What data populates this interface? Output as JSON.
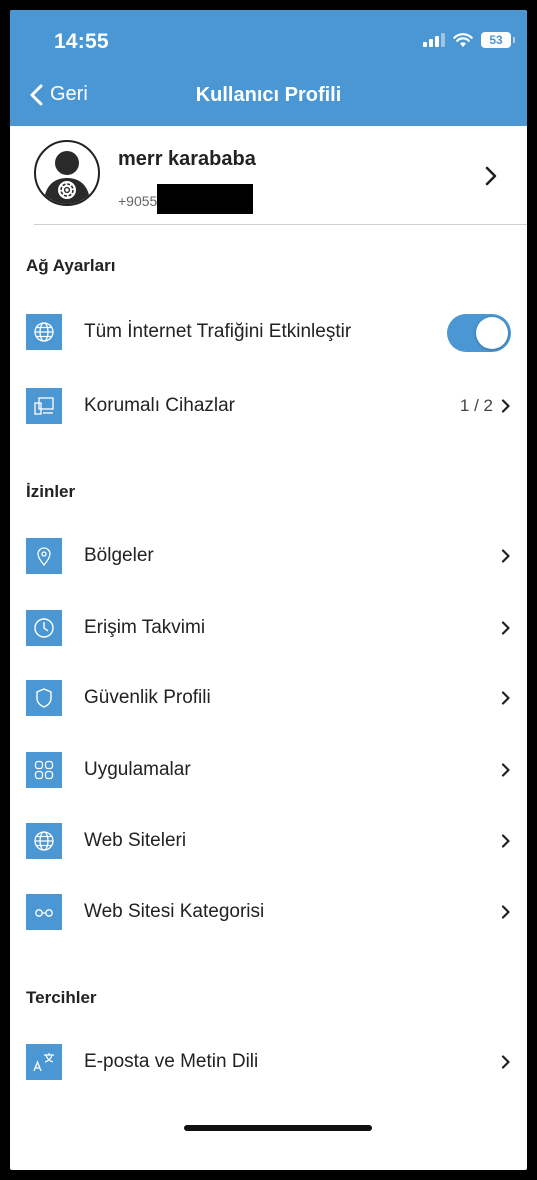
{
  "status_bar": {
    "time": "14:55",
    "battery": "53"
  },
  "nav": {
    "back_label": "Geri",
    "title": "Kullanıcı Profili"
  },
  "profile": {
    "name": "merr karababa",
    "phone_visible": "+9055"
  },
  "sections": {
    "network": {
      "title": "Ağ Ayarları",
      "items": [
        {
          "label": "Tüm İnternet Trafiğini Etkinleştir",
          "icon": "globe-icon",
          "toggle": true
        },
        {
          "label": "Korumalı Cihazlar",
          "icon": "devices-icon",
          "value": "1 / 2"
        }
      ]
    },
    "permissions": {
      "title": "İzinler",
      "items": [
        {
          "label": "Bölgeler",
          "icon": "location-pin-icon"
        },
        {
          "label": "Erişim Takvimi",
          "icon": "clock-icon"
        },
        {
          "label": "Güvenlik Profili",
          "icon": "shield-icon"
        },
        {
          "label": "Uygulamalar",
          "icon": "apps-grid-icon"
        },
        {
          "label": "Web Siteleri",
          "icon": "globe-icon"
        },
        {
          "label": "Web Sitesi Kategorisi",
          "icon": "glasses-icon"
        }
      ]
    },
    "preferences": {
      "title": "Tercihler",
      "items": [
        {
          "label": "E-posta ve Metin Dili",
          "icon": "translate-icon"
        }
      ]
    }
  },
  "colors": {
    "accent": "#4a97d3",
    "text": "#222222"
  }
}
